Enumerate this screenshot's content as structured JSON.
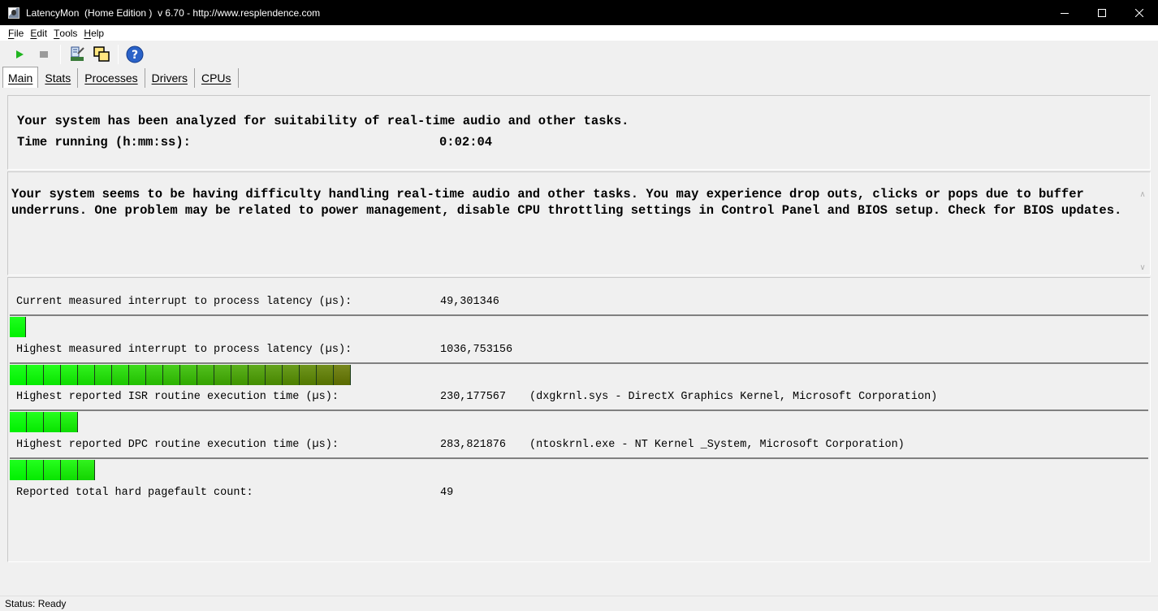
{
  "window": {
    "title": "LatencyMon  (Home Edition )  v 6.70 - http://www.resplendence.com",
    "controls": {
      "minimize": "minimize-icon",
      "maximize": "maximize-icon",
      "close": "close-icon"
    }
  },
  "menu": [
    {
      "key": "F",
      "rest": "ile"
    },
    {
      "key": "E",
      "rest": "dit"
    },
    {
      "key": "T",
      "rest": "ools"
    },
    {
      "key": "H",
      "rest": "elp"
    }
  ],
  "toolbar": {
    "buttons": [
      "play-icon",
      "stop-icon",
      "driver-icon",
      "cpu-windows-icon",
      "help-icon"
    ],
    "accent": "#1fb51f"
  },
  "tabs": [
    "Main",
    "Stats",
    "Processes",
    "Drivers",
    "CPUs"
  ],
  "active_tab": "Main",
  "summary": {
    "analysis_line": "Your system has been analyzed for suitability of real-time audio and other tasks.",
    "time_label": "Time running (h:mm:ss):",
    "time_value": "0:02:04"
  },
  "conclusion": "Your system seems to be having difficulty handling real-time audio and other tasks. You may experience drop outs, clicks or pops due to buffer underruns. One problem may be related to power management, disable CPU throttling settings in Control Panel and BIOS setup. Check for BIOS updates.",
  "stats": [
    {
      "label": "Current measured interrupt to process latency (µs):",
      "value": "49,301346",
      "extra": "",
      "bar_segments": 1
    },
    {
      "label": "Highest measured interrupt to process latency (µs):",
      "value": "1036,753156",
      "extra": "",
      "bar_segments": 20
    },
    {
      "label": "Highest reported ISR routine execution time (µs):",
      "value": "230,177567",
      "extra": "(dxgkrnl.sys - DirectX Graphics Kernel, Microsoft Corporation)",
      "bar_segments": 4
    },
    {
      "label": "Highest reported DPC routine execution time (µs):",
      "value": "283,821876",
      "extra": "(ntoskrnl.exe - NT Kernel _System, Microsoft Corporation)",
      "bar_segments": 5
    }
  ],
  "pagefault": {
    "label": "Reported total hard pagefault count:",
    "value": "49"
  },
  "status": "Status: Ready",
  "colors": {
    "bar_green": "#00f000",
    "bar_olive": "#5a6a00",
    "title_bg": "#000000"
  }
}
